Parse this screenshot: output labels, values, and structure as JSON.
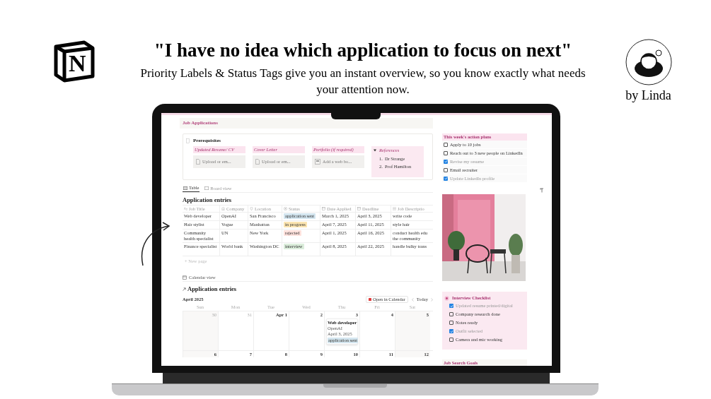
{
  "logo": {
    "letter": "N"
  },
  "headline": "\"I have no idea which application to focus on next\"",
  "subheadline": "Priority Labels & Status Tags give you an instant overview, so you know exactly what needs your attention now.",
  "author": "by Linda",
  "screen": {
    "page_title": "Job Applications",
    "prerequisites": {
      "title": "Prerequisites",
      "fields": [
        {
          "label": "Updated Resume/ CV",
          "placeholder": "Upload or em..."
        },
        {
          "label": "Cover Letter",
          "placeholder": "Upload or em..."
        },
        {
          "label": "Portfolio (if required)",
          "placeholder": "Add a web bo..."
        }
      ],
      "references": {
        "title": "References",
        "expanded": true,
        "items": [
          {
            "number": "1.",
            "text": "Dr Strange"
          },
          {
            "number": "2.",
            "text": "Prof Hamilton"
          }
        ]
      }
    },
    "views": [
      {
        "label": "Table",
        "selected": true
      },
      {
        "label": "Board view",
        "selected": false
      }
    ],
    "table": {
      "title": "Application entries",
      "columns": [
        "Job Title",
        "Company",
        "Location",
        "Status",
        "Date Applied",
        "Deadline",
        "Job Descriptio"
      ],
      "rows": [
        {
          "job_title": "Web developer",
          "company": "OpenAI",
          "location": "San Francisco",
          "status": {
            "label": "application sent",
            "color": "#d3e5ef"
          },
          "date_applied": "March 1, 2025",
          "deadline": "April 3, 2025",
          "description": "write code"
        },
        {
          "job_title": "Hair stylist",
          "company": "Vogue",
          "location": "Manhattan",
          "status": {
            "label": "in progress",
            "color": "#fbe4b0"
          },
          "date_applied": "April 7, 2025",
          "deadline": "April 11, 2025",
          "description": "style hair"
        },
        {
          "job_title": "Community health specialist",
          "company": "UN",
          "location": "New York",
          "status": {
            "label": "rejected",
            "color": "#ffe2dd"
          },
          "date_applied": "April 1, 2025",
          "deadline": "April 16, 2025",
          "description": "conduct health edu\nthe community"
        },
        {
          "job_title": "Finance specialist",
          "company": "World bank",
          "location": "Washington DC",
          "status": {
            "label": "interview",
            "color": "#dbeddb"
          },
          "date_applied": "April 8, 2025",
          "deadline": "April 22, 2025",
          "description": "handle bulky trans"
        }
      ],
      "new_row": "+ New page"
    },
    "calendar": {
      "view_label": "Calendar view",
      "title": "Application entries",
      "month": "April 2025",
      "open_button": "Open in Calendar",
      "today_button": "Today",
      "weekdays": [
        "Sun",
        "Mon",
        "Tue",
        "Wed",
        "Thu",
        "Fri",
        "Sat"
      ],
      "weeks": [
        [
          {
            "label": "30",
            "outside": true
          },
          {
            "label": "31",
            "outside": true
          },
          {
            "label": "Apr 1",
            "outside": false
          },
          {
            "label": "2",
            "outside": false
          },
          {
            "label": "3",
            "outside": false,
            "events": [
              {
                "title": "Web developer",
                "company": "OpenAI",
                "date": "April 3, 2025",
                "status": {
                  "label": "application sent",
                  "color": "#d3e5ef"
                }
              }
            ]
          },
          {
            "label": "4",
            "outside": false
          },
          {
            "label": "5",
            "outside": false
          }
        ],
        [
          {
            "label": "6",
            "outside": false
          },
          {
            "label": "7",
            "outside": false
          },
          {
            "label": "8",
            "outside": false
          },
          {
            "label": "9",
            "outside": false
          },
          {
            "label": "10",
            "outside": false
          },
          {
            "label": "11",
            "outside": false
          },
          {
            "label": "12",
            "outside": false
          }
        ]
      ]
    },
    "action_plans": {
      "title": "This week's action plans",
      "items": [
        {
          "label": "Apply to 10 jobs",
          "checked": false
        },
        {
          "label": "Reach out to 3 new people on LinkedIn",
          "checked": false
        },
        {
          "label": "Revise my resume",
          "checked": true
        },
        {
          "label": "Email recruiter",
          "checked": false
        },
        {
          "label": "Update LinkedIn profile",
          "checked": true
        }
      ]
    },
    "interview_checklist": {
      "title": "Interview Checklist",
      "items": [
        {
          "label": "Updated resume printed/digital",
          "checked": true
        },
        {
          "label": "Company research done",
          "checked": false
        },
        {
          "label": "Notes ready",
          "checked": false
        },
        {
          "label": "Outfit selected",
          "checked": true
        },
        {
          "label": "Camera and mic working",
          "checked": false
        }
      ]
    },
    "goals_title": "Job Search Goals"
  }
}
